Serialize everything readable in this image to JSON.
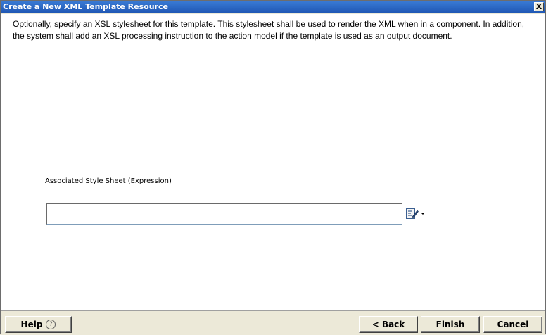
{
  "window": {
    "title": "Create a New XML Template Resource",
    "close_label": "X"
  },
  "content": {
    "description": "Optionally, specify an XSL stylesheet for this template.  This stylesheet shall be used to render the XML when in a component.  In addition, the system shall add an XSL processing instruction to the action model if the template is used as an output document.",
    "field_label": "Associated Style Sheet (Expression)",
    "field_value": "",
    "expression_button_icon": "edit-expression-icon"
  },
  "footer": {
    "help_label": "Help",
    "help_icon_glyph": "?",
    "back_label": "< Back",
    "finish_label": "Finish",
    "cancel_label": "Cancel"
  }
}
